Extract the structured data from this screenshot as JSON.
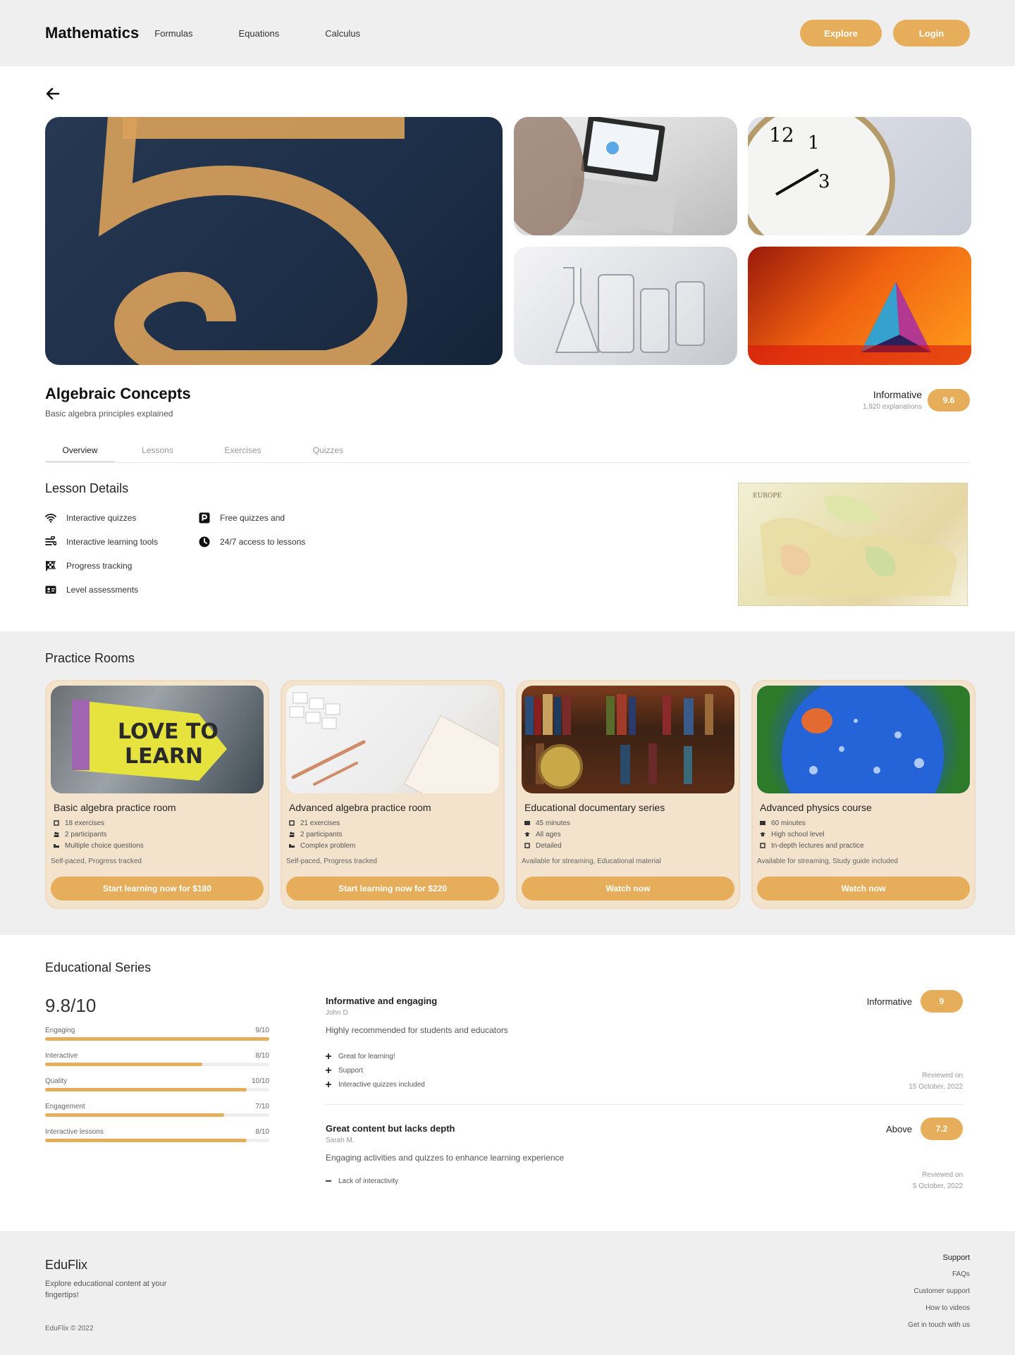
{
  "nav": {
    "brand": "Mathematics",
    "links": [
      "Formulas",
      "Equations",
      "Calculus"
    ],
    "explore_label": "Explore",
    "login_label": "Login"
  },
  "course": {
    "title": "Algebraic Concepts",
    "subtitle": "Basic algebra principles explained",
    "rating_label": "Informative",
    "rating_count": "1,920 explanations",
    "score": "9.6"
  },
  "tabs": [
    "Overview",
    "Lessons",
    "Exercises",
    "Quizzes"
  ],
  "lesson_details": {
    "title": "Lesson Details",
    "col1": [
      {
        "icon": "wifi-icon",
        "label": "Interactive quizzes"
      },
      {
        "icon": "wind-icon",
        "label": "Interactive learning tools"
      },
      {
        "icon": "flag-checkered-icon",
        "label": "Progress tracking"
      },
      {
        "icon": "id-card-icon",
        "label": "Level assessments"
      }
    ],
    "col2": [
      {
        "icon": "parking-icon",
        "label": "Free quizzes and"
      },
      {
        "icon": "clock-icon",
        "label": "24/7 access to lessons"
      }
    ]
  },
  "practice": {
    "title": "Practice Rooms",
    "cards": [
      {
        "title": "Basic algebra practice room",
        "items": [
          "18 exercises",
          "2 participants",
          "Multiple choice questions"
        ],
        "meta": "Self-paced, Progress tracked",
        "button": "Start learning now for $180"
      },
      {
        "title": "Advanced algebra practice room",
        "items": [
          "21 exercises",
          "2 participants",
          "Complex problem"
        ],
        "meta": "Self-paced, Progress tracked",
        "button": "Start learning now for $220"
      },
      {
        "title": "Educational documentary series",
        "items": [
          "45 minutes",
          "All ages",
          "Detailed"
        ],
        "meta": "Available for streaming, Educational material",
        "button": "Watch now"
      },
      {
        "title": "Advanced physics course",
        "items": [
          "60 minutes",
          "High school level",
          "In-depth lectures and practice"
        ],
        "meta": "Available for streaming, Study guide included",
        "button": "Watch now"
      }
    ]
  },
  "series": {
    "title": "Educational Series",
    "overall": "9.8/10",
    "bars": [
      {
        "label": "Engaging",
        "value": "9/10",
        "fill": 1.0
      },
      {
        "label": "Interactive",
        "value": "8/10",
        "fill": 0.7
      },
      {
        "label": "Quality",
        "value": "10/10",
        "fill": 0.9
      },
      {
        "label": "Engagement",
        "value": "7/10",
        "fill": 0.8
      },
      {
        "label": "Interactive lessons",
        "value": "8/10",
        "fill": 0.9
      }
    ],
    "reviews": [
      {
        "title": "Informative and engaging",
        "author": "John D.",
        "text": "Highly recommended for students and educators",
        "points": [
          {
            "type": "plus",
            "text": "Great for learning!"
          },
          {
            "type": "plus",
            "text": "Support"
          },
          {
            "type": "plus",
            "text": "Interactive quizzes included"
          }
        ],
        "rating_label": "Informative",
        "score": "9",
        "reviewed_label": "Reviewed on",
        "date": "15 October, 2022"
      },
      {
        "title": "Great content but lacks depth",
        "author": "Sarah M.",
        "text": "Engaging activities and quizzes to enhance learning experience",
        "points": [
          {
            "type": "minus",
            "text": "Lack of interactivity"
          }
        ],
        "rating_label": "Above",
        "score": "7.2",
        "reviewed_label": "Reviewed on",
        "date": "5 October, 2022"
      }
    ]
  },
  "footer": {
    "brand": "EduFlix",
    "description": "Explore educational content at your fingertips!",
    "copyright": "EduFlix © 2022",
    "links_heading": "Support",
    "links": [
      "FAQs",
      "Customer support",
      "How to videos",
      "Get in touch with us"
    ]
  },
  "colors": {
    "accent": "#e6ae5a",
    "card_bg": "#f3e3cd",
    "band_bg": "#efefef"
  }
}
